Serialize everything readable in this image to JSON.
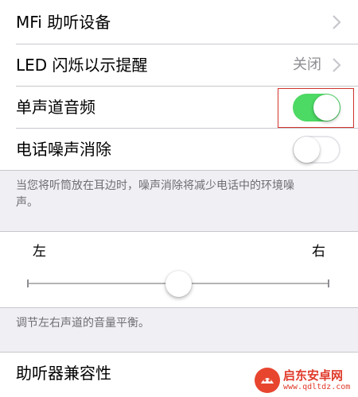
{
  "rows": {
    "mfi": {
      "label": "MFi 助听设备"
    },
    "led": {
      "label": "LED 闪烁以示提醒",
      "value": "关闭"
    },
    "mono": {
      "label": "单声道音频",
      "on": true
    },
    "noise": {
      "label": "电话噪声消除",
      "on": false
    }
  },
  "noise_footer": "当您将听筒放在耳边时，噪声消除将减少电话中的环境噪声。",
  "balance": {
    "left_label": "左",
    "right_label": "右",
    "level": 0.5,
    "footer": "调节左右声道的音量平衡。"
  },
  "hearing_aid_compat": {
    "label": "助听器兼容性"
  },
  "watermark": {
    "brand": "启东安卓网",
    "url": "www.qdltdz.com"
  },
  "colors": {
    "switch_on": "#4cd964",
    "highlight": "#d0342c",
    "background": "#efeff4"
  }
}
